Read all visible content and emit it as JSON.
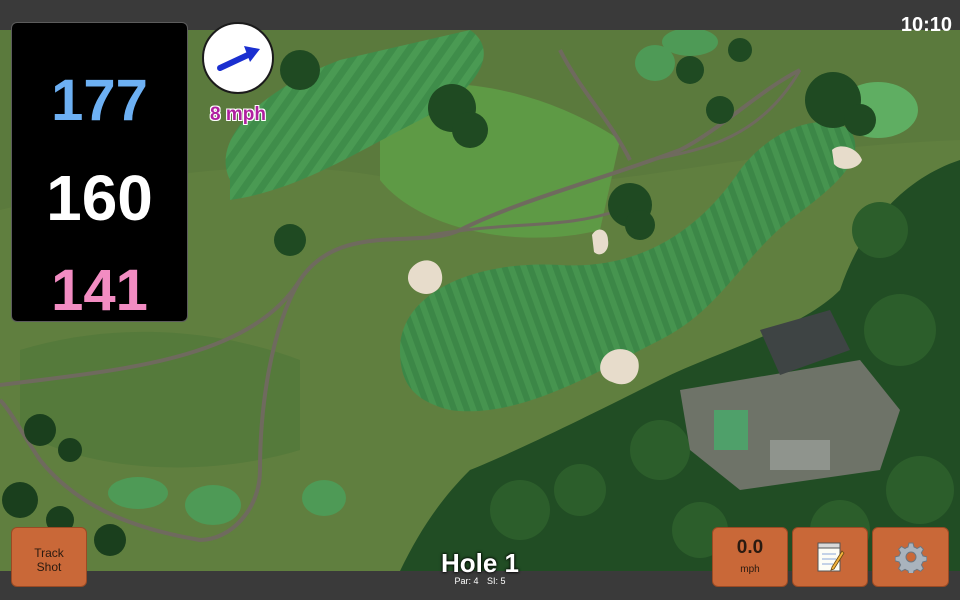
{
  "status_bar": {
    "time": "10:10"
  },
  "yardages": {
    "back": "177",
    "middle": "160",
    "front": "141"
  },
  "wind": {
    "speed": "8 mph",
    "icon": "wind-direction-arrow-icon"
  },
  "hole": {
    "title": "Hole 1",
    "par": "Par: 4",
    "si": "SI: 5"
  },
  "buttons": {
    "track_shot_line1": "Track",
    "track_shot_line2": "Shot",
    "speed_value": "0.0",
    "speed_unit": "mph",
    "notes_icon": "notepad-icon",
    "settings_icon": "gear-icon"
  },
  "colors": {
    "back_yardage": "#6db0f3",
    "middle_yardage": "#ffffff",
    "front_yardage": "#f28cc2",
    "button": "#c96838",
    "wind_text": "#b01fa0"
  }
}
